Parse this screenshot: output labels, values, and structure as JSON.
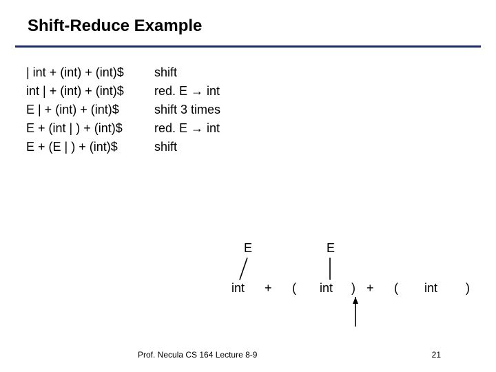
{
  "title": "Shift-Reduce Example",
  "steps": [
    {
      "config": "| int + (int) + (int)$",
      "action": "shift"
    },
    {
      "config": "int | + (int) + (int)$",
      "action": "red. E → int"
    },
    {
      "config": "E | + (int) + (int)$",
      "action": "shift 3 times"
    },
    {
      "config": "E + (int | ) + (int)$",
      "action": "red. E → int"
    },
    {
      "config": "E + (E | ) + (int)$",
      "action": "shift"
    }
  ],
  "tree": {
    "nodes": {
      "E1": "E",
      "E2": "E"
    },
    "tokens": [
      "int",
      "+",
      "(",
      "int",
      ")",
      "+",
      "(",
      "int",
      ")"
    ],
    "arrow_target_index": 4
  },
  "footer": {
    "left": "Prof. Necula  CS 164  Lecture 8-9",
    "right": "21"
  }
}
